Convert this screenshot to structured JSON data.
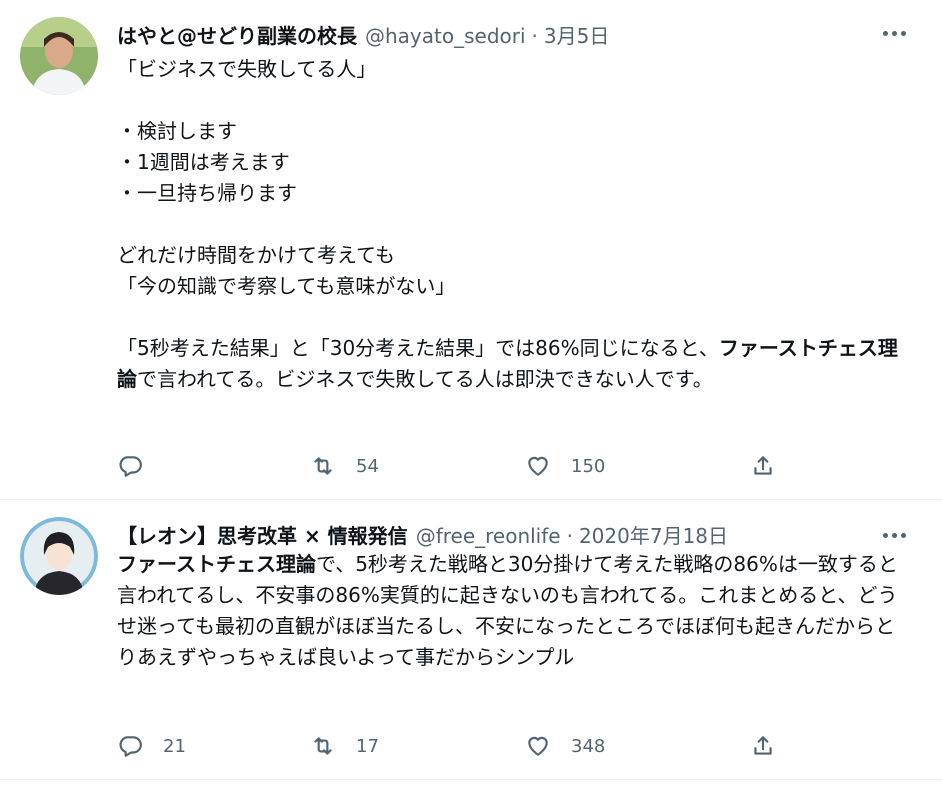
{
  "tweets": [
    {
      "name": "はやと@せどり副業の校長",
      "handle": "@hayato_sedori",
      "separator": "·",
      "date": "3月5日",
      "body_lines": [
        "「ビジネスで失敗してる人」",
        "",
        "・検討します",
        "・1週間は考えます",
        "・一旦持ち帰ります",
        "",
        "どれだけ時間をかけて考えても",
        "「今の知識で考察しても意味がない」",
        ""
      ],
      "para_a": "「5秒考えた結果」と「30分考えた結果」では86%同じになると、",
      "para_b": "ファーストチェス理論",
      "para_c": "で言われてる。ビジネスで失敗してる人は即決できない人です。",
      "reply_count": "",
      "retweet_count": "54",
      "like_count": "150"
    },
    {
      "name": "【レオン】思考改革 × 情報発信",
      "handle": "@free_reonlife",
      "separator": "·",
      "date": "2020年7月18日",
      "para_b": "ファーストチェス理論",
      "para_c": "で、5秒考えた戦略と30分掛けて考えた戦略の86%は一致すると言われてるし、不安事の86%実質的に起きないのも言われてる。これまとめると、どうせ迷っても最初の直観がほぼ当たるし、不安になったところでほぼ何も起きんだからとりあえずやっちゃえば良いよって事だからシンプル",
      "reply_count": "21",
      "retweet_count": "17",
      "like_count": "348"
    }
  ],
  "icons": [
    "more-icon",
    "reply-icon",
    "retweet-icon",
    "like-icon",
    "share-icon"
  ],
  "colors": {
    "text": "#0f1419",
    "secondary": "#536471",
    "divider": "#eff3f4"
  }
}
